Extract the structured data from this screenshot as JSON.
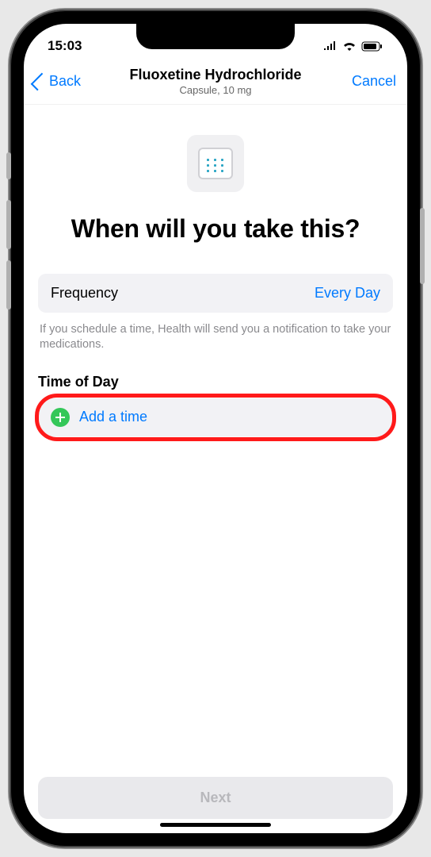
{
  "status": {
    "time": "15:03"
  },
  "nav": {
    "back": "Back",
    "title": "Fluoxetine Hydrochloride",
    "subtitle": "Capsule, 10 mg",
    "cancel": "Cancel"
  },
  "heading": "When will you take this?",
  "frequency": {
    "label": "Frequency",
    "value": "Every Day"
  },
  "helper": "If you schedule a time, Health will send you a notification to take your medications.",
  "section": {
    "time_of_day": "Time of Day",
    "add_time": "Add a time"
  },
  "footer": {
    "next": "Next"
  }
}
